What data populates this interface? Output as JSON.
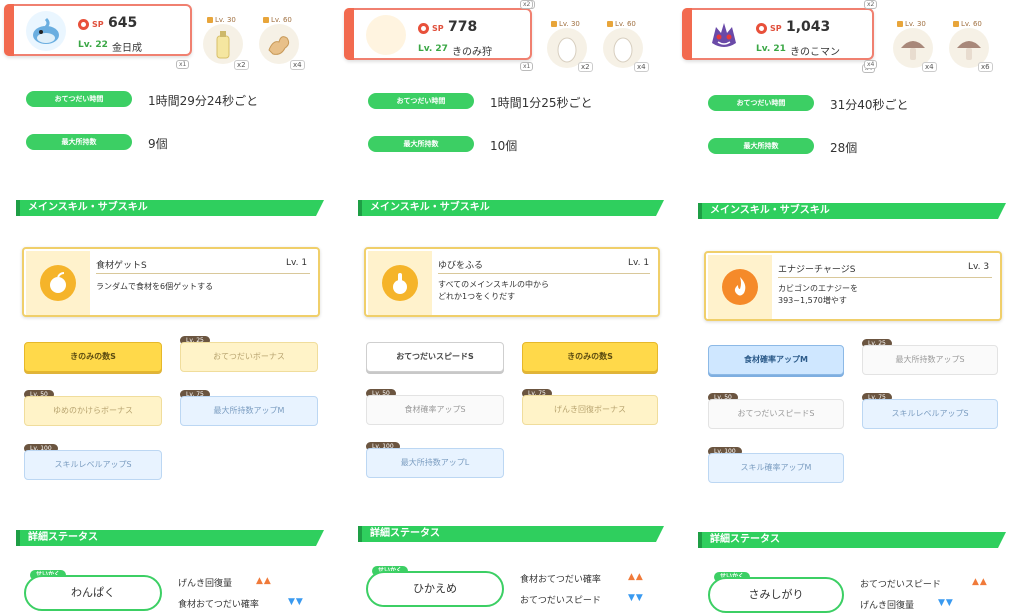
{
  "columns": [
    {
      "pokemon": {
        "sp_label": "SP",
        "sp": "645",
        "level": "Lv. 22",
        "name": "金日成"
      },
      "ingredients": [
        {
          "lock_lv": "Lv. 30",
          "qty": "x2"
        },
        {
          "lock_lv": "Lv. 60",
          "qty": "x4"
        }
      ],
      "stats": [
        {
          "label": "おてつだい時間",
          "value": "1時間29分24秒ごと"
        },
        {
          "label": "最大所持数",
          "value": "9個"
        }
      ],
      "skills_header": "メインスキル・サブスキル",
      "main_skill": {
        "name": "食材ゲットS",
        "level": "Lv. 1",
        "desc": [
          "ランダムで食材を6個ゲットする"
        ]
      },
      "subskills": [
        {
          "label": "きのみの数S",
          "lock": "",
          "style": "gold"
        },
        {
          "label": "おてつだいボーナス",
          "lock": "Lv. 25",
          "style": "gold-dim"
        },
        {
          "label": "ゆめのかけらボーナス",
          "lock": "Lv. 50",
          "style": "gold-dim"
        },
        {
          "label": "最大所持数アップM",
          "lock": "Lv. 75",
          "style": "blue-dim"
        },
        {
          "label": "スキルレベルアップS",
          "lock": "Lv. 100",
          "style": "blue-dim"
        }
      ],
      "detail_header": "詳細ステータス",
      "nature": {
        "tag": "せいかく",
        "name": "わんぱく"
      },
      "effects": [
        {
          "label": "げんき回復量",
          "dir": "up",
          "arrows": "▲▲"
        },
        {
          "label": "食材おてつだい確率",
          "dir": "down",
          "arrows": "▼▼"
        }
      ]
    },
    {
      "pokemon": {
        "sp_label": "SP",
        "sp": "778",
        "level": "Lv. 27",
        "name": "きのみ狩"
      },
      "ingredients": [
        {
          "lock_lv": "Lv. 30",
          "qty": "x2"
        },
        {
          "lock_lv": "Lv. 60",
          "qty": "x4"
        }
      ],
      "stats": [
        {
          "label": "おてつだい時間",
          "value": "1時間1分25秒ごと"
        },
        {
          "label": "最大所持数",
          "value": "10個"
        }
      ],
      "skills_header": "メインスキル・サブスキル",
      "main_skill": {
        "name": "ゆびをふる",
        "level": "Lv. 1",
        "desc": [
          "すべてのメインスキルの中から",
          "どれか1つをくりだす"
        ]
      },
      "subskills": [
        {
          "label": "おてつだいスピードS",
          "lock": "",
          "style": "white"
        },
        {
          "label": "きのみの数S",
          "lock": "",
          "style": "gold"
        },
        {
          "label": "食材確率アップS",
          "lock": "Lv. 50",
          "style": "white-dim"
        },
        {
          "label": "げんき回復ボーナス",
          "lock": "Lv. 75",
          "style": "gold-dim"
        },
        {
          "label": "最大所持数アップL",
          "lock": "Lv. 100",
          "style": "blue-dim"
        }
      ],
      "detail_header": "詳細ステータス",
      "nature": {
        "tag": "せいかく",
        "name": "ひかえめ"
      },
      "effects": [
        {
          "label": "食材おてつだい確率",
          "dir": "up",
          "arrows": "▲▲"
        },
        {
          "label": "おてつだいスピード",
          "dir": "down",
          "arrows": "▼▼"
        }
      ]
    },
    {
      "pokemon": {
        "sp_label": "SP",
        "sp": "1,043",
        "level": "Lv. 21",
        "name": "きのこマン"
      },
      "ingredients": [
        {
          "lock_lv": "Lv. 30",
          "qty": "x4"
        },
        {
          "lock_lv": "Lv. 60",
          "qty": "x6"
        }
      ],
      "stats": [
        {
          "label": "おてつだい時間",
          "value": "31分40秒ごと"
        },
        {
          "label": "最大所持数",
          "value": "28個"
        }
      ],
      "skills_header": "メインスキル・サブスキル",
      "main_skill": {
        "name": "エナジーチャージS",
        "level": "Lv. 3",
        "desc": [
          "カビゴンのエナジーを",
          "393~1,570増やす"
        ]
      },
      "subskills": [
        {
          "label": "食材確率アップM",
          "lock": "",
          "style": "blue"
        },
        {
          "label": "最大所持数アップS",
          "lock": "Lv. 25",
          "style": "white-dim"
        },
        {
          "label": "おてつだいスピードS",
          "lock": "Lv. 50",
          "style": "white-dim"
        },
        {
          "label": "スキルレベルアップS",
          "lock": "Lv. 75",
          "style": "blue-dim"
        },
        {
          "label": "スキル確率アップM",
          "lock": "Lv. 100",
          "style": "blue-dim"
        }
      ],
      "detail_header": "詳細ステータス",
      "nature": {
        "tag": "せいかく",
        "name": "さみしがり"
      },
      "effects": [
        {
          "label": "おてつだいスピード",
          "dir": "up",
          "arrows": "▲▲"
        },
        {
          "label": "げんき回復量",
          "dir": "down",
          "arrows": "▼▼"
        }
      ]
    }
  ],
  "mini_tags": [
    "x1",
    "x2",
    "x4",
    "x2",
    "x1",
    "x2",
    "x4"
  ],
  "colors": {
    "accent_green": "#3ccf64",
    "header_red": "#f26a4f",
    "gold": "#ffd94a",
    "blue": "#cfe7ff"
  }
}
